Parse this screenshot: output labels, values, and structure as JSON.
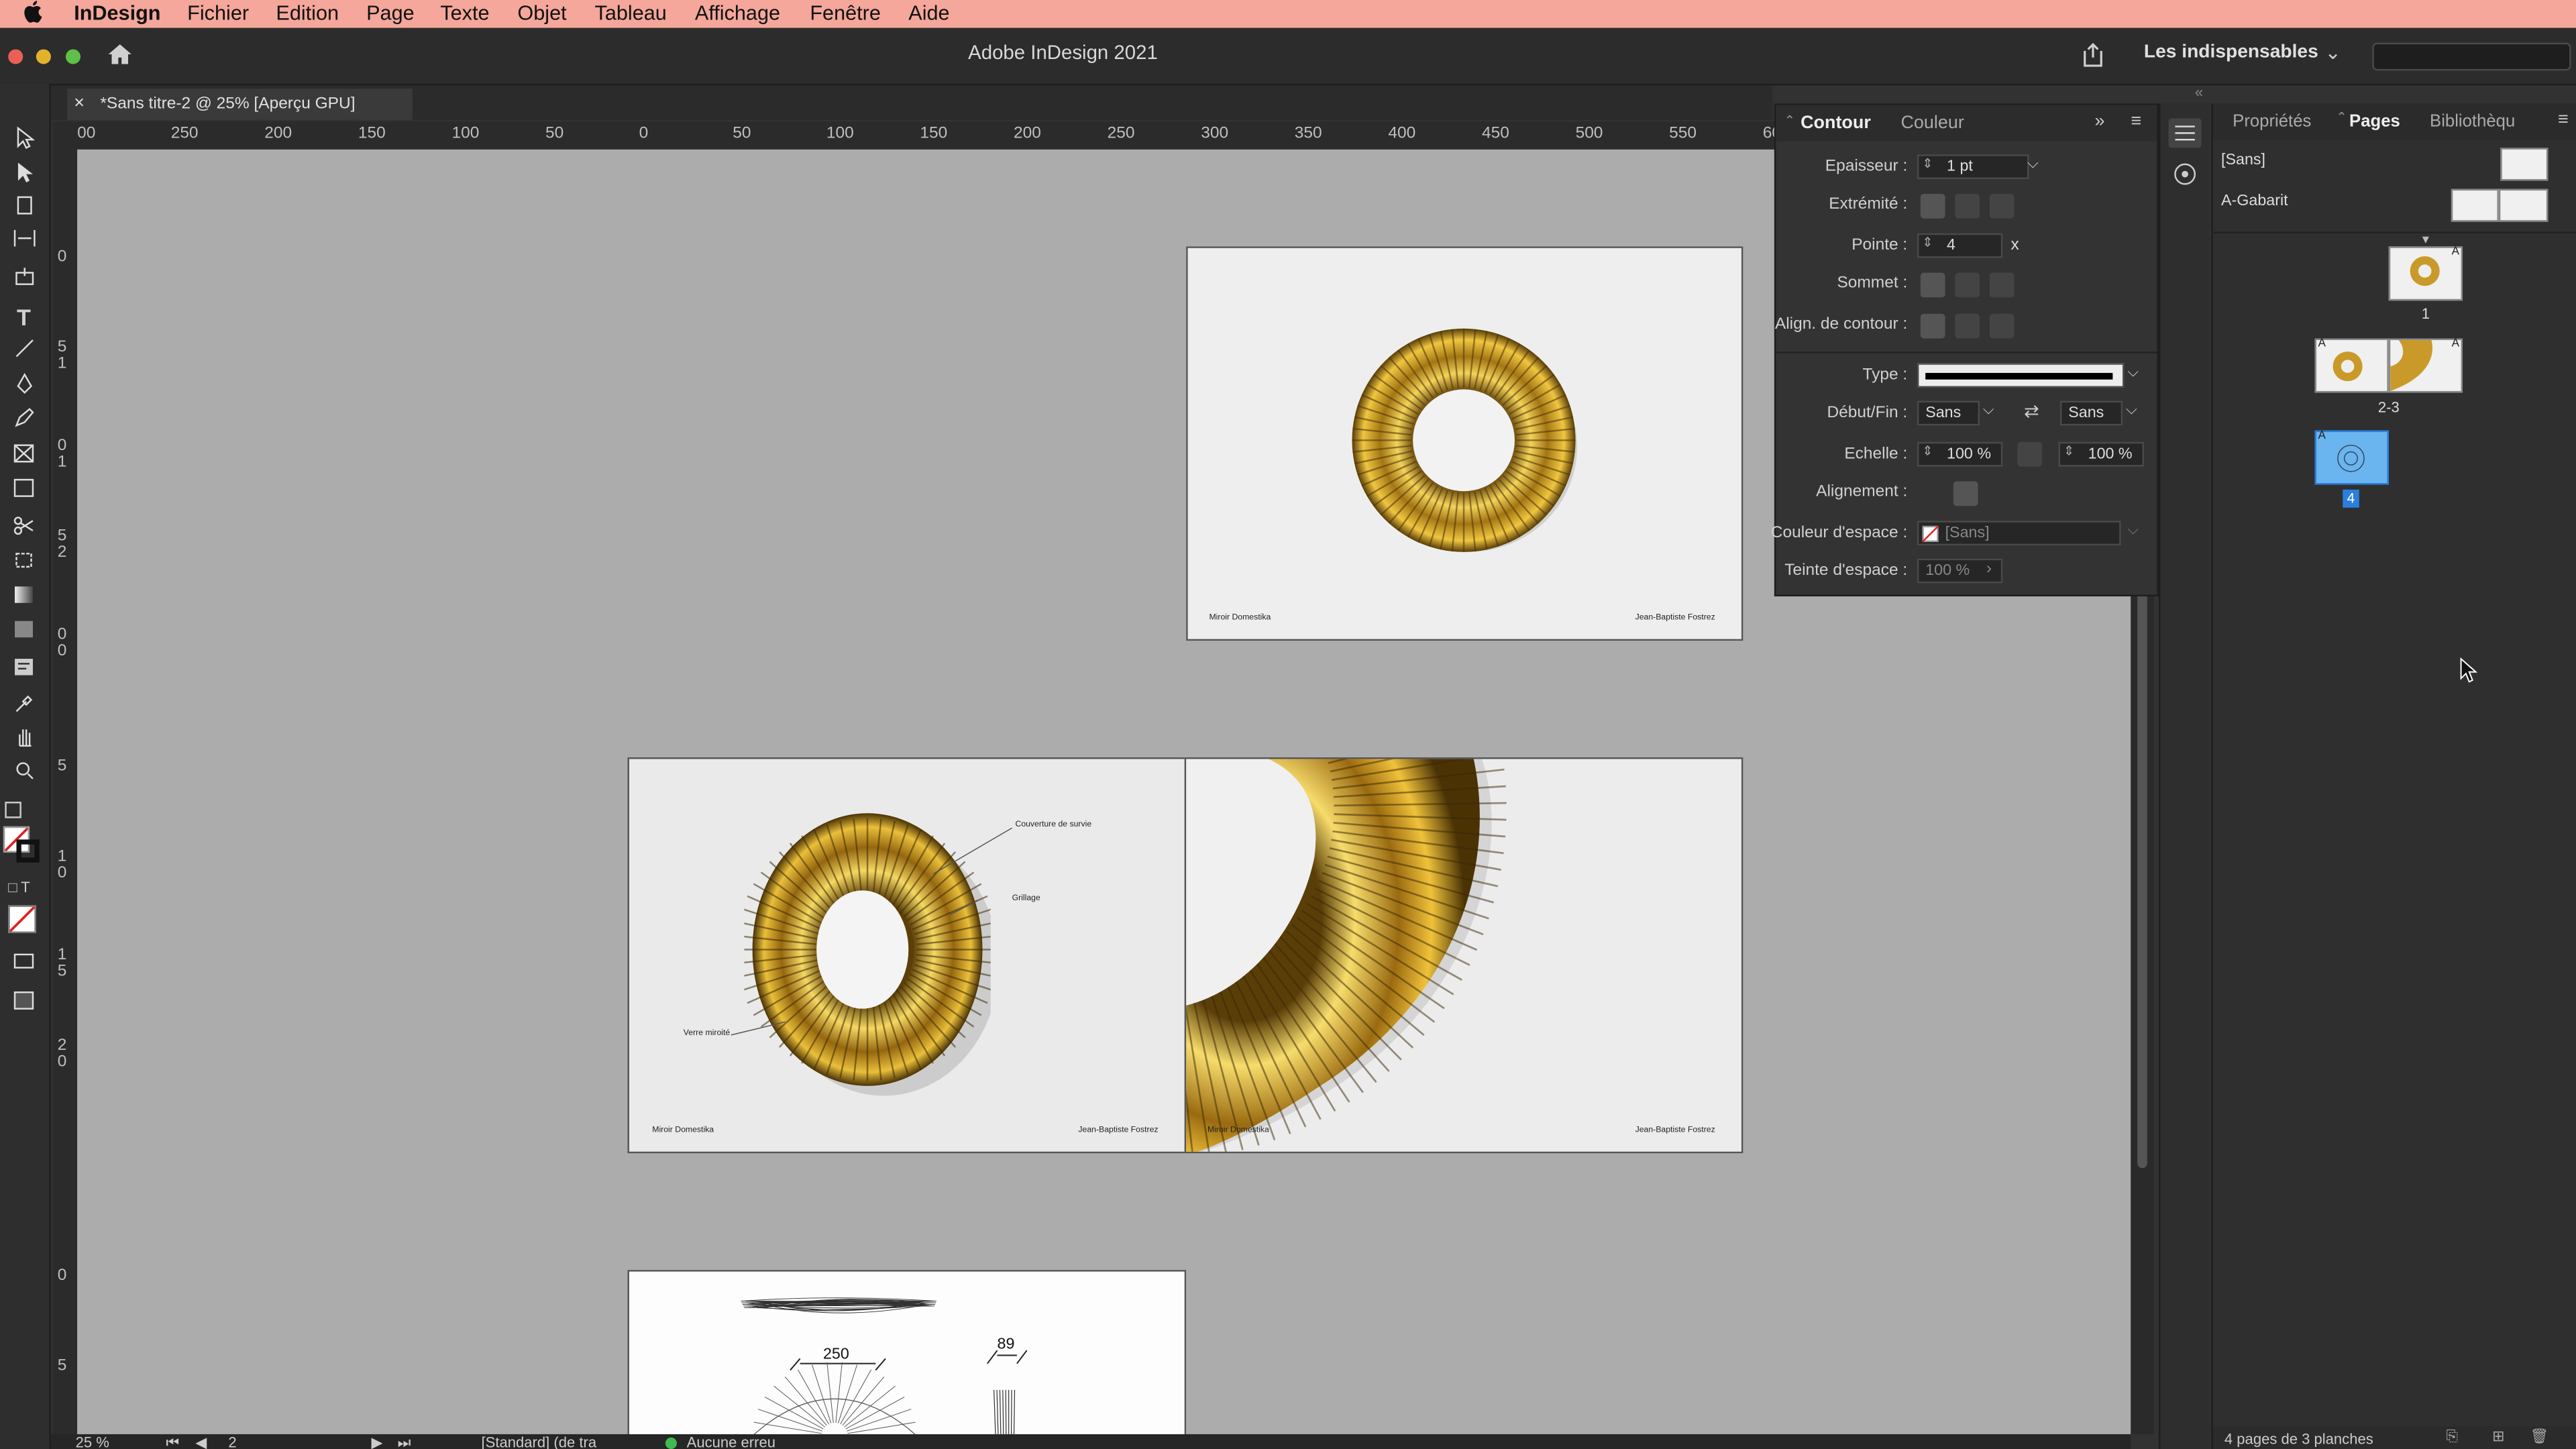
{
  "menubar": {
    "apple": "",
    "app": "InDesign",
    "items": [
      "Fichier",
      "Edition",
      "Page",
      "Texte",
      "Objet",
      "Tableau",
      "Affichage",
      "Fenêtre",
      "Aide"
    ]
  },
  "titlebar": {
    "title": "Adobe InDesign 2021",
    "workspace": "Les indispensables",
    "workspace_arrow": "⌄"
  },
  "document": {
    "close": "×",
    "tab": "*Sans titre-2 @ 25% [Aperçu GPU]"
  },
  "rulers": {
    "h": [
      "00",
      "250",
      "200",
      "150",
      "100",
      "50",
      "0",
      "50",
      "100",
      "150",
      "200",
      "250",
      "300",
      "350",
      "400",
      "450",
      "500",
      "550",
      "60"
    ],
    "v": [
      "0",
      "5",
      "1",
      "0",
      "1",
      "5",
      "2",
      "0",
      "0",
      "5",
      "1",
      "0",
      "1",
      "5",
      "2",
      "0",
      "0",
      "5"
    ]
  },
  "pages": {
    "page1": {
      "left": "Miroir Domestika",
      "right": "Jean-Baptiste Fostrez"
    },
    "page2": {
      "left": "Miroir Domestika",
      "right": "Jean-Baptiste Fostrez",
      "annotations": [
        "Couverture de survie",
        "Grillage",
        "Verre miroité"
      ]
    },
    "page3": {
      "left": "Miroir Domestika",
      "right": "Jean-Baptiste Fostrez"
    },
    "page4": {
      "dim1": "250",
      "dim2": "89"
    }
  },
  "contour": {
    "tabs": [
      "Contour",
      "Couleur"
    ],
    "epaisseur": {
      "label": "Epaisseur :",
      "value": "1 pt"
    },
    "extremite": {
      "label": "Extrémité :"
    },
    "pointe": {
      "label": "Pointe :",
      "value": "4",
      "suffix": "x"
    },
    "sommet": {
      "label": "Sommet :"
    },
    "align": {
      "label": "Align. de contour :"
    },
    "type": {
      "label": "Type :"
    },
    "debutfin": {
      "label": "Début/Fin :",
      "start": "Sans",
      "end": "Sans"
    },
    "echelle": {
      "label": "Echelle :",
      "v1": "100 %",
      "v2": "100 %"
    },
    "alignement": {
      "label": "Alignement :"
    },
    "couleur_espace": {
      "label": "Couleur d'espace :",
      "value": "[Sans]"
    },
    "teinte_espace": {
      "label": "Teinte d'espace :",
      "value": "100 %"
    }
  },
  "pagespanel": {
    "tabs": [
      "Propriétés",
      "Pages",
      "Bibliothèqu"
    ],
    "none": "[Sans]",
    "master": "A-Gabarit",
    "labels": [
      "1",
      "2-3",
      "4"
    ],
    "master_letter": "A",
    "footer": "4 pages de 3 planches"
  },
  "status": {
    "zoom": "25 %",
    "page": "2",
    "style": "[Standard] (de tra",
    "errors": "Aucune erreu"
  }
}
